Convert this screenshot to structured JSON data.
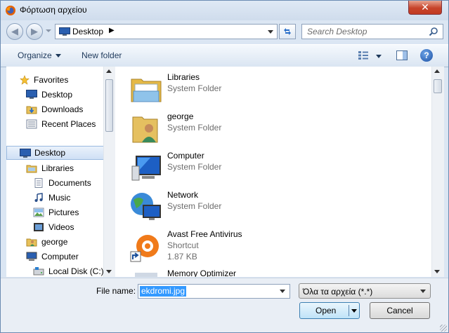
{
  "window": {
    "title": "Φόρτωση αρχείου",
    "close_label": "✕"
  },
  "address": {
    "location": "Desktop",
    "chevron": "▶"
  },
  "search": {
    "placeholder": "Search Desktop"
  },
  "toolbar": {
    "organize_label": "Organize",
    "new_folder_label": "New folder",
    "help_label": "?"
  },
  "nav": {
    "favorites_header": "Favorites",
    "favorites": [
      {
        "label": "Desktop",
        "icon": "desktop-icon"
      },
      {
        "label": "Downloads",
        "icon": "downloads-icon"
      },
      {
        "label": "Recent Places",
        "icon": "recent-places-icon"
      }
    ],
    "tree": [
      {
        "label": "Desktop",
        "icon": "desktop-icon",
        "selected": true
      },
      {
        "label": "Libraries",
        "icon": "libraries-icon"
      },
      {
        "label": "Documents",
        "icon": "documents-icon"
      },
      {
        "label": "Music",
        "icon": "music-icon"
      },
      {
        "label": "Pictures",
        "icon": "pictures-icon"
      },
      {
        "label": "Videos",
        "icon": "videos-icon"
      },
      {
        "label": "george",
        "icon": "user-folder-icon"
      },
      {
        "label": "Computer",
        "icon": "computer-icon"
      },
      {
        "label": "Local Disk (C:)",
        "icon": "disk-icon"
      }
    ]
  },
  "files": [
    {
      "name": "Libraries",
      "type": "System Folder",
      "icon": "libraries-folder-icon"
    },
    {
      "name": "george",
      "type": "System Folder",
      "icon": "user-folder-icon"
    },
    {
      "name": "Computer",
      "type": "System Folder",
      "icon": "computer-icon"
    },
    {
      "name": "Network",
      "type": "System Folder",
      "icon": "network-icon"
    },
    {
      "name": "Avast Free Antivirus",
      "type": "Shortcut",
      "size": "1.87 KB",
      "icon": "avast-shortcut-icon"
    },
    {
      "name": "Memory Optimizer",
      "type": "",
      "icon": "shortcut-icon"
    }
  ],
  "bottom": {
    "file_name_label": "File name:",
    "file_name_value": "ekdromi.jpg",
    "file_type_value": "Όλα τα αρχεία (*.*)",
    "open_label": "Open",
    "cancel_label": "Cancel"
  },
  "colors": {
    "selection": "#3399ff",
    "accent": "#1e395b",
    "close": "#c7432b"
  }
}
